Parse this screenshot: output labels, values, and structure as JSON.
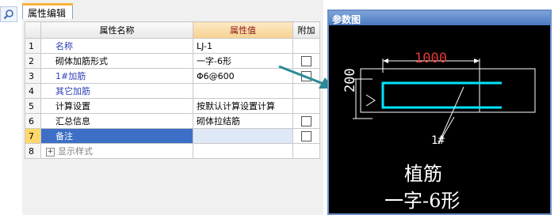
{
  "tab_label": "属性编辑",
  "columns": {
    "index": "",
    "name": "属性名称",
    "value": "属性值",
    "extra": "附加"
  },
  "rows": [
    {
      "index": "1",
      "name": "名称",
      "value": "LJ-1"
    },
    {
      "index": "2",
      "name": "砌体加筋形式",
      "value": "一字-6形"
    },
    {
      "index": "3",
      "name": "1#加筋",
      "value": "Φ6@600"
    },
    {
      "index": "4",
      "name": "其它加筋",
      "value": ""
    },
    {
      "index": "5",
      "name": "计算设置",
      "value": "按默认计算设置计算"
    },
    {
      "index": "6",
      "name": "汇总信息",
      "value": "砌体拉结筋"
    },
    {
      "index": "7",
      "name": "备注",
      "value": ""
    },
    {
      "index": "8",
      "name": "显示样式",
      "value": ""
    }
  ],
  "reference": {
    "title": "参数图",
    "dim_length": "1000",
    "dim_height": "200",
    "bar_mark": "1#",
    "caption_line1": "植筋",
    "caption_line2": "一字-6形"
  },
  "colors": {
    "accent": "#f7b23b",
    "selected_row": "#3d6fc7",
    "rebar": "#00e5ff",
    "dimension": "#e53935",
    "arrow": "#2b8a94"
  }
}
